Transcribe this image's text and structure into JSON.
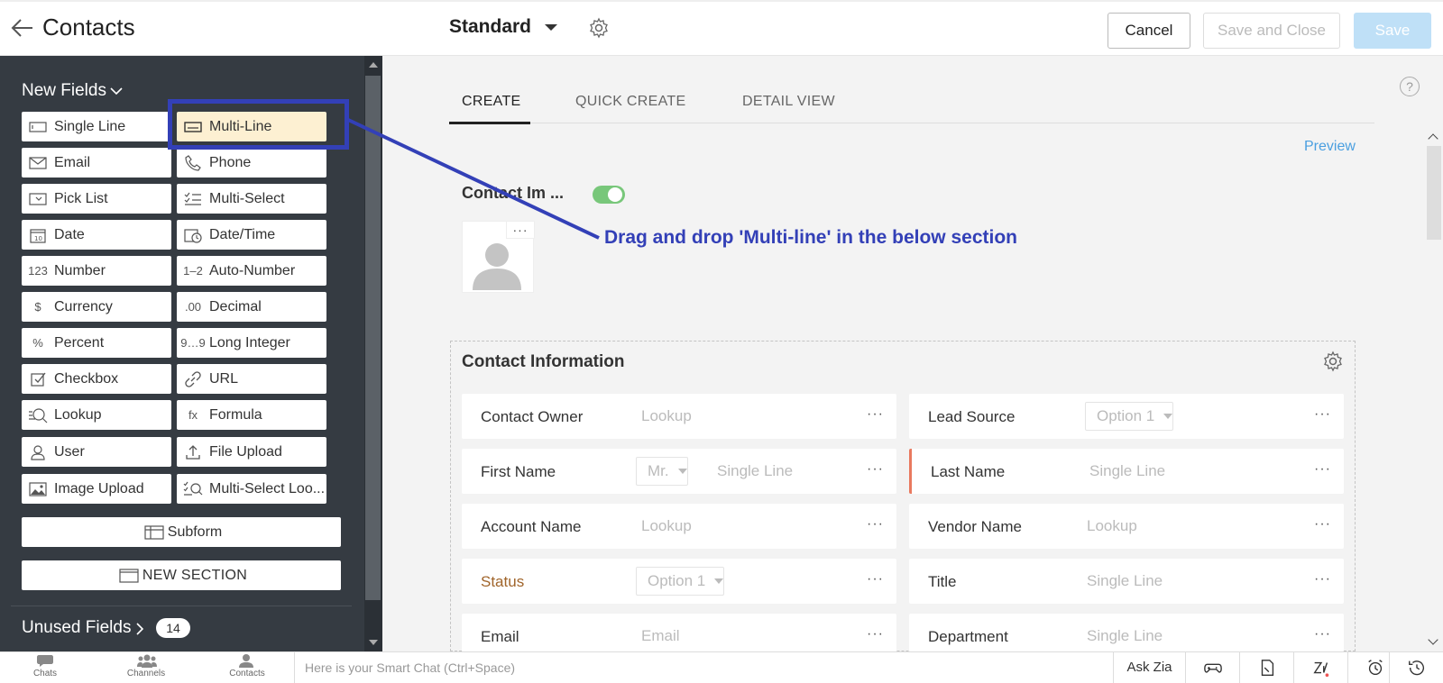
{
  "header": {
    "title": "Contacts",
    "layout_name": "Standard",
    "buttons": {
      "cancel": "Cancel",
      "save_and_close": "Save and Close",
      "save": "Save"
    }
  },
  "sidebar": {
    "new_fields_title": "New Fields",
    "fields": [
      {
        "label": "Single Line",
        "icon": "single-line-icon"
      },
      {
        "label": "Multi-Line",
        "icon": "multi-line-icon",
        "selected": true
      },
      {
        "label": "Email",
        "icon": "email-icon"
      },
      {
        "label": "Phone",
        "icon": "phone-icon"
      },
      {
        "label": "Pick List",
        "icon": "picklist-icon"
      },
      {
        "label": "Multi-Select",
        "icon": "multi-select-icon"
      },
      {
        "label": "Date",
        "icon": "date-icon"
      },
      {
        "label": "Date/Time",
        "icon": "datetime-icon"
      },
      {
        "label": "Number",
        "icon": "number-icon",
        "glyph": "123"
      },
      {
        "label": "Auto-Number",
        "icon": "auto-number-icon",
        "glyph": "1–2"
      },
      {
        "label": "Currency",
        "icon": "currency-icon",
        "glyph": "$"
      },
      {
        "label": "Decimal",
        "icon": "decimal-icon",
        "glyph": ".00"
      },
      {
        "label": "Percent",
        "icon": "percent-icon",
        "glyph": "%"
      },
      {
        "label": "Long Integer",
        "icon": "long-integer-icon",
        "glyph": "9…9"
      },
      {
        "label": "Checkbox",
        "icon": "checkbox-icon"
      },
      {
        "label": "URL",
        "icon": "url-icon"
      },
      {
        "label": "Lookup",
        "icon": "lookup-icon"
      },
      {
        "label": "Formula",
        "icon": "formula-icon",
        "glyph": "fx"
      },
      {
        "label": "User",
        "icon": "user-icon"
      },
      {
        "label": "File Upload",
        "icon": "file-upload-icon"
      },
      {
        "label": "Image Upload",
        "icon": "image-upload-icon"
      },
      {
        "label": "Multi-Select Loo...",
        "icon": "multi-select-lookup-icon"
      }
    ],
    "subform": "Subform",
    "new_section": "NEW SECTION",
    "unused_fields_title": "Unused Fields",
    "unused_count": "14"
  },
  "tabs": [
    {
      "label": "CREATE",
      "active": true
    },
    {
      "label": "QUICK CREATE",
      "active": false
    },
    {
      "label": "DETAIL VIEW",
      "active": false
    }
  ],
  "preview_link": "Preview",
  "contact_image": {
    "label": "Contact Im ...",
    "enabled": true,
    "menu": "···"
  },
  "annotation": "Drag and drop 'Multi-line' in the below section",
  "section": {
    "title": "Contact Information",
    "rows": [
      {
        "left": {
          "label": "Contact Owner",
          "value": "Lookup"
        },
        "right": {
          "label": "Lead Source",
          "dropdown": "Option 1"
        }
      },
      {
        "left": {
          "label": "First Name",
          "salutation": "Mr.",
          "value": "Single Line"
        },
        "right": {
          "label": "Last Name",
          "value": "Single Line",
          "mandatory": true
        }
      },
      {
        "left": {
          "label": "Account Name",
          "value": "Lookup"
        },
        "right": {
          "label": "Vendor Name",
          "value": "Lookup"
        }
      },
      {
        "left": {
          "label": "Status",
          "dropdown": "Option 1",
          "orange": true
        },
        "right": {
          "label": "Title",
          "value": "Single Line"
        }
      },
      {
        "left": {
          "label": "Email",
          "value": "Email"
        },
        "right": {
          "label": "Department",
          "value": "Single Line"
        }
      }
    ],
    "row_menu": "···"
  },
  "bottombar": {
    "items": [
      {
        "label": "Chats",
        "icon": "chat-icon"
      },
      {
        "label": "Channels",
        "icon": "channels-icon"
      },
      {
        "label": "Contacts",
        "icon": "contact-icon"
      }
    ],
    "smart_chat_placeholder": "Here is your Smart Chat (Ctrl+Space)",
    "ask_zia": "Ask Zia"
  }
}
